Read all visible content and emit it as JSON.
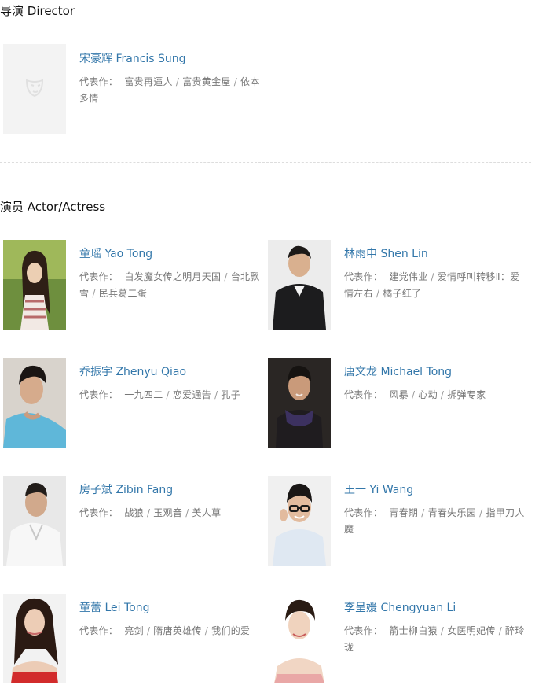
{
  "director_section": {
    "title": "导演 Director",
    "people": [
      {
        "name": "宋豪辉 Francis Sung",
        "works_label": "代表作：",
        "works": [
          "富贵再逼人",
          "富贵黄金屋",
          "依本多情"
        ],
        "photo": "placeholder-mask-icon"
      }
    ]
  },
  "actor_section": {
    "title": "演员 Actor/Actress",
    "people": [
      {
        "name": "童瑶 Yao Tong",
        "works_label": "代表作：",
        "works": [
          "白发魔女传之明月天国",
          "台北飘雪",
          "民兵葛二蛋"
        ],
        "photo": "actress-outdoor-green"
      },
      {
        "name": "林雨申 Shen Lin",
        "works_label": "代表作：",
        "works": [
          "建党伟业",
          "爱情呼叫转移Ⅱ：爱情左右",
          "橘子红了"
        ],
        "photo": "actor-black-suit"
      },
      {
        "name": "乔振宇 Zhenyu Qiao",
        "works_label": "代表作：",
        "works": [
          "一九四二",
          "恋爱通告",
          "孔子"
        ],
        "photo": "actor-blue-shirt"
      },
      {
        "name": "唐文龙 Michael Tong",
        "works_label": "代表作：",
        "works": [
          "风暴",
          "心动",
          "拆弹专家"
        ],
        "photo": "actor-scarf-dark"
      },
      {
        "name": "房子斌 Zibin Fang",
        "works_label": "代表作：",
        "works": [
          "战狼",
          "玉观音",
          "美人草"
        ],
        "photo": "actor-white-jacket"
      },
      {
        "name": "王一 Yi Wang",
        "works_label": "代表作：",
        "works": [
          "青春期",
          "青春失乐园",
          "指甲刀人魔"
        ],
        "photo": "actor-glasses"
      },
      {
        "name": "童蕾 Lei Tong",
        "works_label": "代表作：",
        "works": [
          "亮剑",
          "隋唐英雄传",
          "我们的爱"
        ],
        "photo": "actress-red-dress"
      },
      {
        "name": "李呈媛 Chengyuan Li",
        "works_label": "代表作：",
        "works": [
          "箭士柳白猿",
          "女医明妃传",
          "醉玲珑"
        ],
        "photo": "actress-pink-top"
      }
    ]
  }
}
